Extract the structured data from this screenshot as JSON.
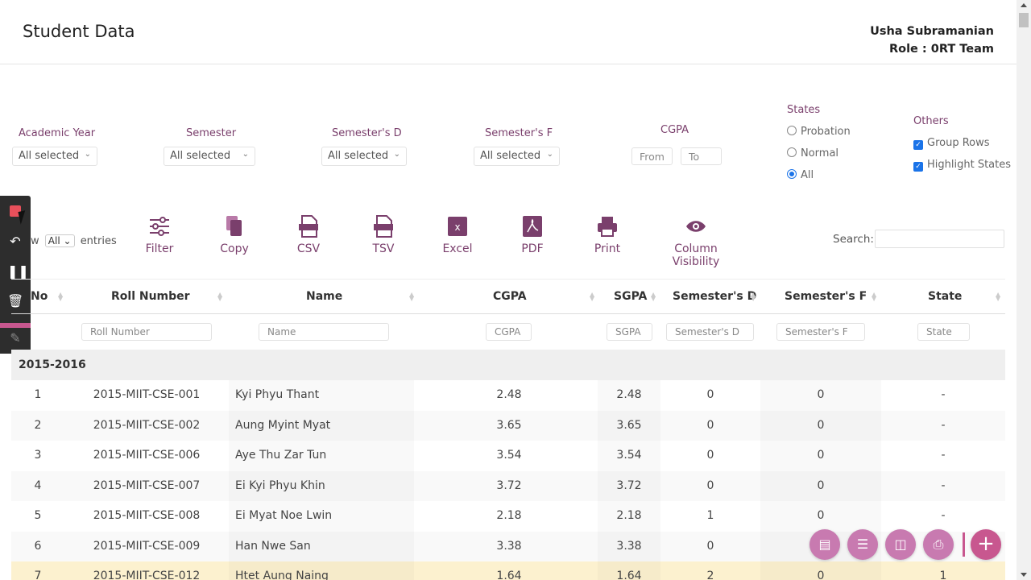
{
  "header": {
    "title": "Student Data",
    "user_name": "Usha Subramanian",
    "user_role": "Role : 0RT Team"
  },
  "filters": {
    "academic_year": {
      "label": "Academic Year",
      "value": "All selected"
    },
    "semester": {
      "label": "Semester",
      "value": "All selected"
    },
    "semester_d": {
      "label": "Semester's D",
      "value": "All selected"
    },
    "semester_f": {
      "label": "Semester's F",
      "value": "All selected"
    },
    "cgpa": {
      "label": "CGPA",
      "from_placeholder": "From",
      "to_placeholder": "To"
    },
    "states": {
      "label": "States",
      "options": [
        "Probation",
        "Normal",
        "All"
      ],
      "selected": "All"
    },
    "others": {
      "label": "Others",
      "group_rows": "Group Rows",
      "highlight_states": "Highlight States"
    }
  },
  "entries": {
    "prefix": "w",
    "value": "All",
    "suffix": "entries"
  },
  "toolbar": {
    "filter": "Filter",
    "copy": "Copy",
    "csv": "CSV",
    "tsv": "TSV",
    "excel": "Excel",
    "pdf": "PDF",
    "print": "Print",
    "column_visibility": "Column Visibility"
  },
  "search": {
    "label": "Search:"
  },
  "table": {
    "headers": [
      "No",
      "Roll Number",
      "Name",
      "CGPA",
      "SGPA",
      "Semester's D",
      "Semester's F",
      "State"
    ],
    "filter_placeholders": [
      "Roll Number",
      "Name",
      "CGPA",
      "SGPA",
      "Semester's D",
      "Semester's F",
      "State"
    ],
    "group": "2015-2016",
    "rows": [
      [
        "1",
        "2015-MIIT-CSE-001",
        "Kyi Phyu Thant",
        "2.48",
        "2.48",
        "0",
        "0",
        "-"
      ],
      [
        "2",
        "2015-MIIT-CSE-002",
        "Aung Myint Myat",
        "3.65",
        "3.65",
        "0",
        "0",
        "-"
      ],
      [
        "3",
        "2015-MIIT-CSE-006",
        "Aye Thu Zar Tun",
        "3.54",
        "3.54",
        "0",
        "0",
        "-"
      ],
      [
        "4",
        "2015-MIIT-CSE-007",
        "Ei Kyi Phyu Khin",
        "3.72",
        "3.72",
        "0",
        "0",
        "-"
      ],
      [
        "5",
        "2015-MIIT-CSE-008",
        "Ei Myat Noe Lwin",
        "2.18",
        "2.18",
        "1",
        "0",
        "-"
      ],
      [
        "6",
        "2015-MIIT-CSE-009",
        "Han Nwe San",
        "3.38",
        "3.38",
        "0",
        "",
        ""
      ],
      [
        "7",
        "2015-MIIT-CSE-012",
        "Htet Aung Naing",
        "1.64",
        "1.64",
        "2",
        "0",
        "1"
      ]
    ]
  },
  "colors": {
    "accent": "#7a3f6c",
    "fab": "#c87ab0",
    "fab_primary": "#c8578f",
    "highlight_row": "#fcf1cf"
  }
}
